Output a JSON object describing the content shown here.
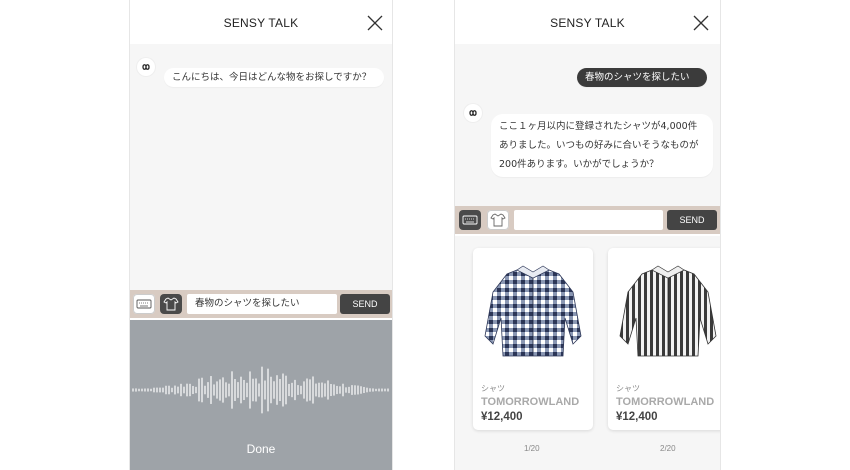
{
  "left_screen": {
    "header": {
      "title": "SENSY TALK"
    },
    "bot_message": "こんにちは、今日はどんな物をお探しですか？",
    "input": {
      "value": "春物のシャツを探したい",
      "send_label": "SEND"
    },
    "voice": {
      "done_label": "Done"
    }
  },
  "right_screen": {
    "header": {
      "title": "SENSY TALK"
    },
    "user_message": "春物のシャツを探したい",
    "bot_message_lines": [
      "ここ１ヶ月以内に登録されたシャツが4,000件",
      "ありました。いつもの好みに合いそうなものが",
      "200件あります。いかがでしょうか？"
    ],
    "input": {
      "value": "",
      "send_label": "SEND"
    },
    "products": [
      {
        "category": "シャツ",
        "brand": "TOMORROWLAND",
        "price": "¥12,400",
        "pager": "1/20"
      },
      {
        "category": "シャツ",
        "brand": "TOMORROWLAND",
        "price": "¥12,400",
        "pager": "2/20"
      }
    ]
  },
  "icons": [
    "close-icon",
    "sensy-logo-icon",
    "keyboard-icon",
    "shirt-icon",
    "waveform"
  ],
  "colors": {
    "input_bar": "#d8cbc2",
    "voice_panel": "#9ea3a8",
    "dark_button": "#444444",
    "chat_bg": "#f6f6f6"
  }
}
